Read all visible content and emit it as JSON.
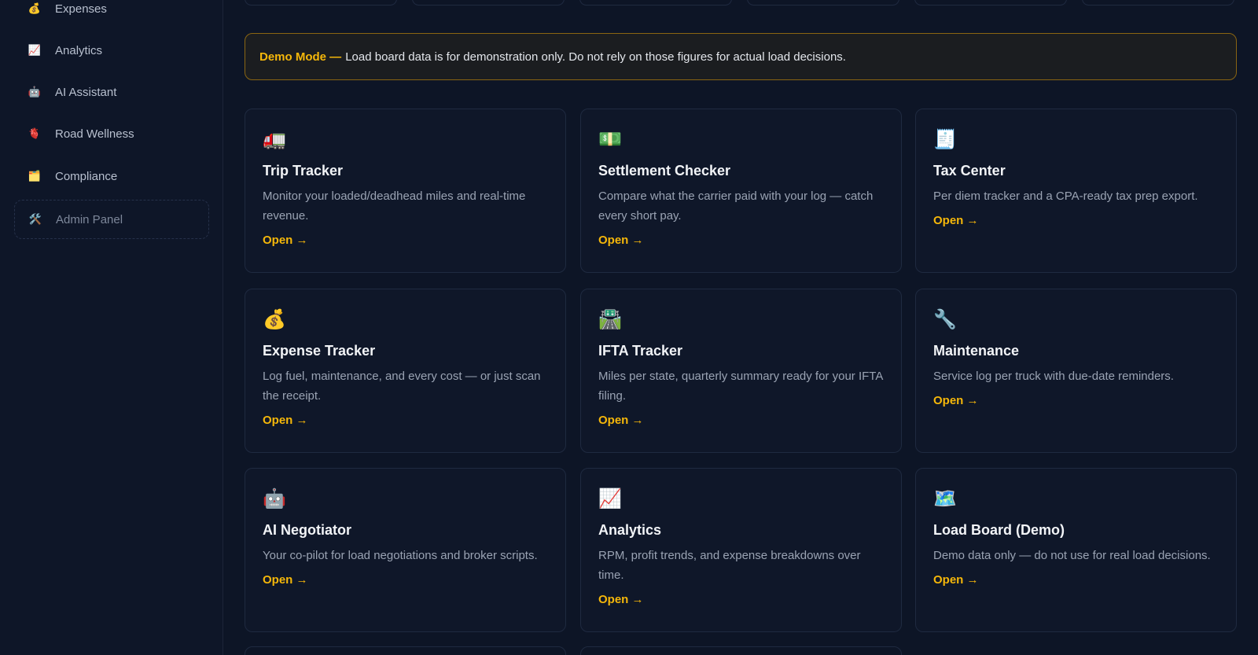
{
  "sidebar": {
    "items": [
      {
        "icon": "money-bag-icon",
        "glyph": "💰",
        "label": "Expenses"
      },
      {
        "icon": "chart-icon",
        "glyph": "📈",
        "label": "Analytics"
      },
      {
        "icon": "robot-icon",
        "glyph": "🤖",
        "label": "AI Assistant"
      },
      {
        "icon": "heart-icon",
        "glyph": "🫀",
        "label": "Road Wellness"
      },
      {
        "icon": "folder-icon",
        "glyph": "🗂️",
        "label": "Compliance"
      }
    ],
    "admin": {
      "icon": "hammer-wrench-icon",
      "glyph": "🛠️",
      "label": "Admin Panel"
    }
  },
  "banner": {
    "title": "Demo Mode —",
    "text": "Load board data is for demonstration only. Do not rely on those figures for actual load decisions.",
    "accent_color": "#f5b70a"
  },
  "cards": [
    {
      "icon": "truck-icon",
      "glyph": "🚛",
      "title": "Trip Tracker",
      "desc": "Monitor your loaded/deadhead miles and real-time revenue.",
      "link": "Open →"
    },
    {
      "icon": "money-icon",
      "glyph": "💵",
      "title": "Settlement Checker",
      "desc": "Compare what the carrier paid with your log — catch every short pay.",
      "link": "Open →"
    },
    {
      "icon": "receipt-icon",
      "glyph": "🧾",
      "title": "Tax Center",
      "desc": "Per diem tracker and a CPA-ready tax prep export.",
      "link": "Open →"
    },
    {
      "icon": "money-bag-icon",
      "glyph": "💰",
      "title": "Expense Tracker",
      "desc": "Log fuel, maintenance, and every cost — or just scan the receipt.",
      "link": "Open →"
    },
    {
      "icon": "highway-icon",
      "glyph": "🛣️",
      "title": "IFTA Tracker",
      "desc": "Miles per state, quarterly summary ready for your IFTA filing.",
      "link": "Open →"
    },
    {
      "icon": "wrench-icon",
      "glyph": "🔧",
      "title": "Maintenance",
      "desc": "Service log per truck with due-date reminders.",
      "link": "Open →"
    },
    {
      "icon": "robot-icon",
      "glyph": "🤖",
      "title": "AI Negotiator",
      "desc": "Your co-pilot for load negotiations and broker scripts.",
      "link": "Open →"
    },
    {
      "icon": "chart-icon",
      "glyph": "📈",
      "title": "Analytics",
      "desc": "RPM, profit trends, and expense breakdowns over time.",
      "link": "Open →"
    },
    {
      "icon": "map-icon",
      "glyph": "🗺️",
      "title": "Load Board (Demo)",
      "desc": "Demo data only — do not use for real load decisions.",
      "link": "Open →"
    }
  ]
}
